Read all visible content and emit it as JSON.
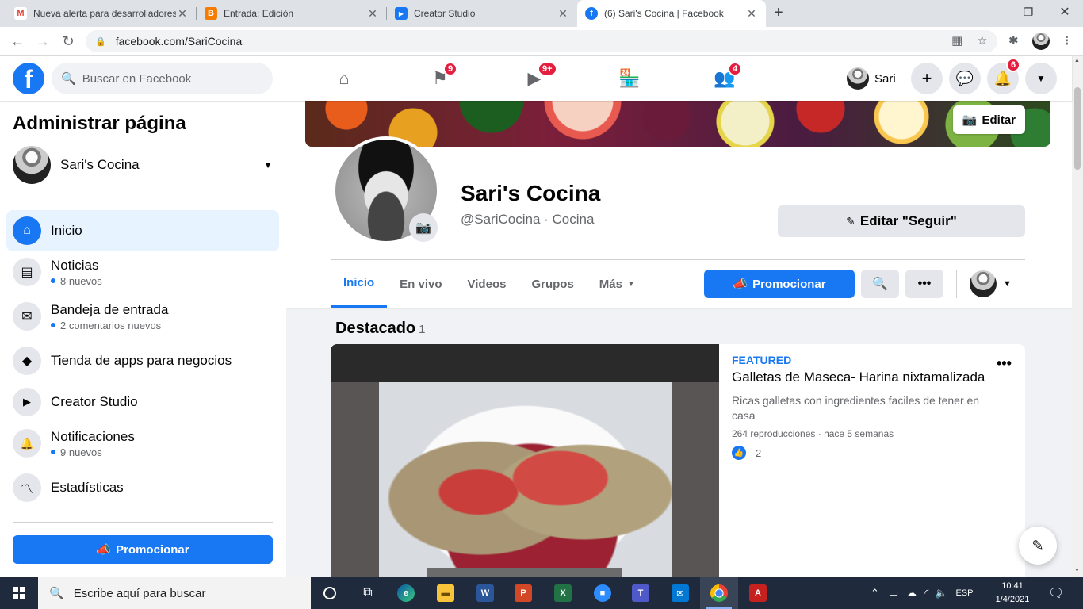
{
  "browser": {
    "tabs": [
      {
        "title": "Nueva alerta para desarrolladores",
        "favicon": "gmail-icon",
        "color": "#ea4335",
        "glyph": "M"
      },
      {
        "title": "Entrada: Edición",
        "favicon": "blogger-icon",
        "color": "#f57c00",
        "glyph": "B"
      },
      {
        "title": "Creator Studio",
        "favicon": "creator-studio-icon",
        "color": "#1877f2",
        "glyph": "▶"
      },
      {
        "title": "(6) Sari's Cocina | Facebook",
        "favicon": "facebook-icon",
        "color": "#1877f2",
        "glyph": "f"
      }
    ],
    "url": "facebook.com/SariCocina"
  },
  "fb_header": {
    "search_placeholder": "Buscar en Facebook",
    "nav_badges": {
      "pages": "9",
      "watch": "9+",
      "groups": "4"
    },
    "user_name": "Sari",
    "notif_badge": "6"
  },
  "sidebar": {
    "title": "Administrar página",
    "page_name": "Sari's Cocina",
    "items": [
      {
        "label": "Inicio",
        "sub": "",
        "icon": "home-icon",
        "glyph": "⌂"
      },
      {
        "label": "Noticias",
        "sub": "8 nuevos",
        "icon": "news-feed-icon",
        "glyph": "▤"
      },
      {
        "label": "Bandeja de entrada",
        "sub": "2 comentarios nuevos",
        "icon": "inbox-icon",
        "glyph": "✉"
      },
      {
        "label": "Tienda de apps para negocios",
        "sub": "",
        "icon": "cube-icon",
        "glyph": "◆"
      },
      {
        "label": "Creator Studio",
        "sub": "",
        "icon": "clapper-icon",
        "glyph": "▶"
      },
      {
        "label": "Notificaciones",
        "sub": "9 nuevos",
        "icon": "bell-icon",
        "glyph": "🔔"
      },
      {
        "label": "Estadísticas",
        "sub": "",
        "icon": "insights-icon",
        "glyph": "〽"
      }
    ],
    "promote_label": "Promocionar"
  },
  "profile": {
    "cover_edit_label": "Editar",
    "name": "Sari's Cocina",
    "handle": "@SariCocina · Cocina",
    "follow_button": "Editar \"Seguir\"",
    "tabs": [
      "Inicio",
      "En vivo",
      "Videos",
      "Grupos",
      "Más"
    ],
    "active_tab": "Inicio",
    "promote_label": "Promocionar"
  },
  "featured": {
    "section_title": "Destacado",
    "count": "1",
    "tag": "FEATURED",
    "title": "Galletas de Maseca- Harina nixtamalizada",
    "description": "Ricas galletas con ingredientes faciles de tener en casa",
    "meta": "264 reproducciones · hace 5 semanas",
    "likes": "2"
  },
  "taskbar": {
    "search_placeholder": "Escribe aquí para buscar",
    "lang": "ESP",
    "time": "10:41",
    "date": "1/4/2021"
  }
}
